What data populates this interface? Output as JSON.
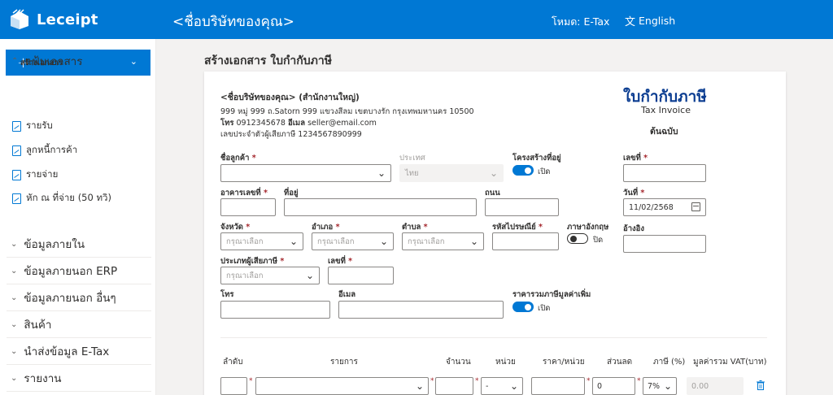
{
  "app": {
    "name": "Leceipt",
    "company_placeholder": "<ชื่อบริษัทของคุณ>"
  },
  "header": {
    "mode": "โหมด: E-Tax",
    "language": "English"
  },
  "sidebar": {
    "create_label": "สร้างเอกสาร",
    "folder_label": "แฟ้มเอกสาร",
    "folder_items": [
      {
        "label": "รายรับ"
      },
      {
        "label": "ลูกหนี้การค้า"
      },
      {
        "label": "รายจ่าย"
      },
      {
        "label": "หัก ณ ที่จ่าย (50 ทวิ)"
      }
    ],
    "sections": [
      {
        "label": "ข้อมูลภายใน"
      },
      {
        "label": "ข้อมูลภายนอก ERP"
      },
      {
        "label": "ข้อมูลภายนอก อื่นๆ"
      },
      {
        "label": "สินค้า"
      },
      {
        "label": "นำส่งข้อมูล E-Tax"
      },
      {
        "label": "รายงาน"
      }
    ]
  },
  "page": {
    "title": "สร้างเอกสาร ใบกำกับภาษี"
  },
  "seller": {
    "name": "<ชื่อบริษัทของคุณ> (สำนักงานใหญ่)",
    "address": "999 หมู่ 999 ถ.Satorn 999 แขวงสีลม เขตบางรัก กรุงเทพมหานคร 10500",
    "phone_label": "โทร",
    "phone": "0912345678",
    "email_label": "อีเมล",
    "email": "seller@email.com",
    "taxid_label": "เลขประจำตัวผู้เสียภาษี",
    "taxid": "1234567890999"
  },
  "document": {
    "title_th": "ใบกำกับภาษี",
    "title_en": "Tax Invoice",
    "copy": "ต้นฉบับ"
  },
  "form": {
    "customer_name_label": "ชื่อลูกค้า",
    "country_label": "ประเทศ",
    "country_value": "ไทย",
    "structure_label": "โครงสร้างที่อยู่",
    "structure_toggle": "เปิด",
    "number_label": "เลขที่",
    "building_label": "อาคารเลขที่",
    "address_label": "ที่อยู่",
    "road_label": "ถนน",
    "date_label": "วันที่",
    "date_value": "11/02/2568",
    "province_label": "จังหวัด",
    "district_label": "อำเภอ",
    "subdistrict_label": "ตำบล",
    "postcode_label": "รหัสไปรษณีย์",
    "english_label": "ภาษาอังกฤษ",
    "english_toggle": "ปิด",
    "reference_label": "อ้างอิง",
    "select_placeholder": "กรุณาเลือก",
    "taxpayer_type_label": "ประเภทผู้เสียภาษี",
    "taxpayer_number_label": "เลขที่",
    "phone_label": "โทร",
    "email_label": "อีเมล",
    "vat_included_label": "ราคารวมภาษีมูลค่าเพิ่ม",
    "vat_included_toggle": "เปิด"
  },
  "table": {
    "headers": [
      "ลำดับ",
      "รายการ",
      "จำนวน",
      "หน่วย",
      "ราคา/หน่วย",
      "ส่วนลด",
      "ภาษี (%)",
      "มูลค่ารวม VAT(บาท)"
    ],
    "row": {
      "unit": "-",
      "discount": "0",
      "tax": "7%",
      "total": "0.00"
    }
  },
  "colors": {
    "primary": "#0078d4",
    "required": "#a4262c",
    "title": "#0b3d91"
  }
}
